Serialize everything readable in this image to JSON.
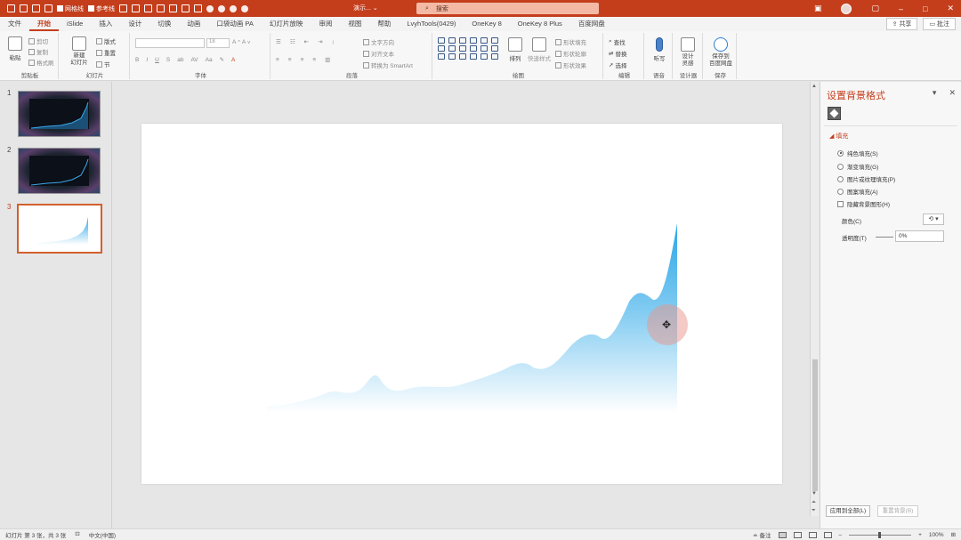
{
  "titlebar": {
    "gridlines_label": "网格线",
    "guides_label": "参考线",
    "doc_title": "演示... ⌄",
    "search_placeholder": "搜索",
    "accent": "#c43e1c"
  },
  "tabs": [
    "文件",
    "开始",
    "iSlide",
    "插入",
    "设计",
    "切换",
    "动画",
    "口袋动画 PA",
    "幻灯片放映",
    "审阅",
    "视图",
    "帮助",
    "LvyhTools(0429)",
    "OneKey 8",
    "OneKey 8 Plus",
    "百度网盘"
  ],
  "active_tab": "开始",
  "share": {
    "share_label": "共享",
    "comment_label": "批注"
  },
  "ribbon": {
    "clipboard": {
      "paste": "粘贴",
      "cut": "剪切",
      "copy": "复制",
      "format_painter": "格式刷",
      "label": "剪贴板"
    },
    "slides": {
      "new_slide": "新建\n幻灯片",
      "layout": "版式",
      "reset": "重置",
      "section": "节",
      "label": "幻灯片"
    },
    "font": {
      "label": "字体",
      "size": "18"
    },
    "paragraph": {
      "text_direction": "文字方向",
      "align_text": "对齐文本",
      "smartart": "转换为 SmartArt",
      "label": "段落"
    },
    "drawing": {
      "arrange": "排列",
      "quick_styles": "快速样式",
      "shape_fill": "形状填充",
      "shape_outline": "形状轮廓",
      "shape_effects": "形状效果",
      "label": "绘图"
    },
    "editing": {
      "find": "查找",
      "replace": "替换",
      "select": "选择",
      "label": "编辑"
    },
    "voice": {
      "dictate": "听写",
      "label": "语音"
    },
    "designer": {
      "design_ideas": "设计\n灵感",
      "label": "设计器"
    },
    "save": {
      "save_baidu": "保存到\n百度网盘",
      "label": "保存"
    }
  },
  "slides": [
    {
      "number": "1",
      "style": "dark"
    },
    {
      "number": "2",
      "style": "dark"
    },
    {
      "number": "3",
      "style": "light",
      "selected": true
    }
  ],
  "pane": {
    "title": "设置背景格式",
    "section_fill": "填充",
    "options": [
      {
        "label": "纯色填充(S)",
        "kind": "radio",
        "checked": true
      },
      {
        "label": "渐变填充(G)",
        "kind": "radio",
        "checked": false
      },
      {
        "label": "图片或纹理填充(P)",
        "kind": "radio",
        "checked": false
      },
      {
        "label": "图案填充(A)",
        "kind": "radio",
        "checked": false
      },
      {
        "label": "隐藏背景图形(H)",
        "kind": "checkbox",
        "checked": false
      }
    ],
    "color_label": "颜色(C)",
    "transparency_label": "透明度(T)",
    "transparency_value": "0%",
    "apply_all": "应用到全部(L)",
    "reset_bg": "重置背景(B)"
  },
  "status": {
    "slide_info": "幻灯片 第 3 张，共 3 张",
    "language": "中文(中国)",
    "notes": "备注",
    "zoom": "100%"
  },
  "colors": {
    "chart_top": "#29a6e6",
    "chart_bottom": "#ffffff"
  }
}
